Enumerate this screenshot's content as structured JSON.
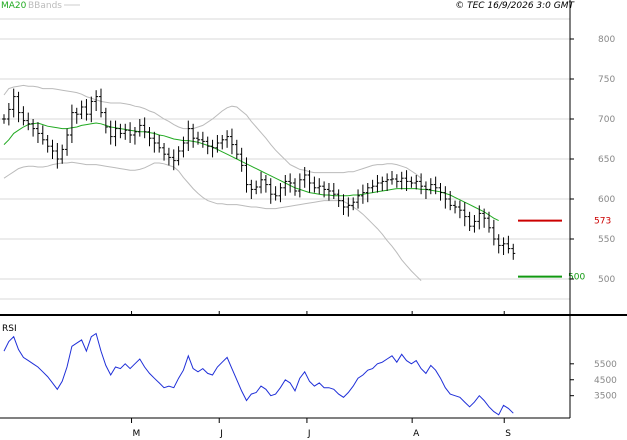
{
  "header": {
    "legend_ma": "MA20",
    "legend_bb": "BBands",
    "copyright": "© TEC 16/9/2026 3:0 GMT"
  },
  "colors": {
    "price": "#000000",
    "ma": "#22aa22",
    "bbands": "#bbbbbb",
    "rsi": "#1f2fd8",
    "resistance": "#cc0000",
    "support": "#119911",
    "grid": "#d8d8d8",
    "axis": "#000000"
  },
  "chart_data": [
    {
      "type": "ohlc",
      "price_axis": {
        "ticks": [
          800,
          750,
          700,
          650,
          600,
          550,
          500
        ],
        "ylim": [
          455,
          830
        ]
      },
      "x_axis": {
        "labels": [
          "M",
          "J",
          "J",
          "A",
          "S"
        ],
        "positions": [
          30,
          50,
          70,
          94,
          115
        ],
        "xlim": [
          0,
          130
        ]
      },
      "levels": [
        {
          "value": 573,
          "label": "573",
          "kind": "resistance"
        },
        {
          "value": 503,
          "label": "500",
          "kind": "support"
        }
      ],
      "close": [
        700,
        712,
        728,
        708,
        698,
        694,
        688,
        682,
        674,
        666,
        660,
        650,
        662,
        680,
        708,
        706,
        715,
        706,
        722,
        728,
        708,
        690,
        678,
        688,
        682,
        686,
        680,
        684,
        692,
        684,
        676,
        670,
        664,
        656,
        652,
        648,
        660,
        670,
        688,
        676,
        674,
        672,
        666,
        664,
        670,
        674,
        678,
        668,
        656,
        642,
        618,
        612,
        615,
        624,
        618,
        606,
        604,
        614,
        622,
        620,
        610,
        624,
        630,
        620,
        614,
        616,
        612,
        610,
        606,
        598,
        590,
        592,
        596,
        604,
        608,
        614,
        616,
        620,
        622,
        624,
        625,
        622,
        626,
        622,
        620,
        622,
        616,
        612,
        618,
        614,
        608,
        600,
        592,
        590,
        586,
        578,
        566,
        572,
        582,
        576,
        564,
        550,
        542,
        544,
        538,
        532
      ],
      "ma20": [
        668,
        674,
        682,
        686,
        690,
        693,
        694,
        695,
        693,
        691,
        690,
        689,
        688,
        688,
        689,
        690,
        692,
        693,
        694,
        695,
        694,
        692,
        690,
        689,
        688,
        687,
        686,
        685,
        684,
        684,
        683,
        682,
        680,
        679,
        677,
        675,
        674,
        673,
        673,
        672,
        671,
        669,
        667,
        665,
        662,
        659,
        656,
        653,
        650,
        647,
        644,
        641,
        638,
        635,
        632,
        629,
        626,
        623,
        620,
        617,
        614,
        612,
        610,
        608,
        607,
        606,
        605,
        605,
        604,
        604,
        604,
        604,
        605,
        605,
        606,
        607,
        608,
        609,
        610,
        611,
        612,
        613,
        613,
        613,
        613,
        613,
        612,
        612,
        611,
        610,
        609,
        607,
        605,
        602,
        599,
        596,
        593,
        590,
        587,
        584,
        580,
        576,
        573
      ],
      "bb_upper": [
        730,
        738,
        740,
        741,
        742,
        741,
        741,
        740,
        738,
        738,
        738,
        737,
        736,
        735,
        734,
        733,
        731,
        728,
        726,
        724,
        722,
        721,
        720,
        720,
        720,
        719,
        718,
        716,
        715,
        713,
        710,
        708,
        704,
        700,
        697,
        693,
        690,
        688,
        688,
        688,
        690,
        692,
        696,
        700,
        705,
        710,
        714,
        716,
        715,
        710,
        705,
        697,
        690,
        683,
        676,
        668,
        661,
        655,
        649,
        643,
        640,
        637,
        636,
        634,
        633,
        633,
        633,
        633,
        633,
        633,
        633,
        634,
        634,
        636,
        638,
        640,
        642,
        643,
        643,
        644,
        644,
        643,
        641,
        639,
        635,
        631,
        626
      ],
      "bb_lower": [
        626,
        630,
        634,
        638,
        640,
        641,
        641,
        640,
        640,
        641,
        643,
        644,
        645,
        645,
        646,
        645,
        644,
        643,
        643,
        643,
        642,
        641,
        640,
        639,
        638,
        637,
        636,
        636,
        637,
        639,
        642,
        645,
        645,
        644,
        642,
        640,
        635,
        627,
        620,
        613,
        607,
        602,
        598,
        596,
        594,
        594,
        593,
        593,
        593,
        592,
        591,
        590,
        590,
        589,
        588,
        588,
        588,
        589,
        590,
        591,
        592,
        593,
        594,
        595,
        596,
        597,
        598,
        598,
        598,
        598,
        597,
        594,
        590,
        586,
        581,
        575,
        569,
        563,
        556,
        548,
        541,
        533,
        524,
        517,
        510,
        504,
        498
      ]
    },
    {
      "type": "line",
      "title": "RSI",
      "y_axis": {
        "ticks": [
          "5500",
          "4500",
          "3500"
        ],
        "tick_values": [
          0.55,
          0.45,
          0.35
        ],
        "ylim": [
          0.21,
          0.85
        ]
      },
      "rsi": [
        0.63,
        0.69,
        0.72,
        0.64,
        0.59,
        0.57,
        0.55,
        0.53,
        0.5,
        0.47,
        0.43,
        0.39,
        0.44,
        0.53,
        0.66,
        0.68,
        0.7,
        0.63,
        0.72,
        0.74,
        0.63,
        0.54,
        0.48,
        0.53,
        0.52,
        0.55,
        0.52,
        0.55,
        0.58,
        0.53,
        0.49,
        0.46,
        0.43,
        0.4,
        0.41,
        0.4,
        0.46,
        0.51,
        0.6,
        0.52,
        0.5,
        0.52,
        0.49,
        0.48,
        0.53,
        0.56,
        0.59,
        0.52,
        0.45,
        0.38,
        0.32,
        0.36,
        0.37,
        0.41,
        0.39,
        0.35,
        0.36,
        0.4,
        0.45,
        0.43,
        0.38,
        0.46,
        0.5,
        0.44,
        0.41,
        0.43,
        0.4,
        0.4,
        0.39,
        0.36,
        0.34,
        0.37,
        0.41,
        0.46,
        0.48,
        0.51,
        0.52,
        0.55,
        0.56,
        0.58,
        0.6,
        0.56,
        0.61,
        0.57,
        0.55,
        0.57,
        0.52,
        0.49,
        0.54,
        0.51,
        0.46,
        0.4,
        0.36,
        0.35,
        0.34,
        0.31,
        0.28,
        0.31,
        0.35,
        0.32,
        0.28,
        0.25,
        0.23,
        0.29,
        0.27,
        0.24
      ]
    }
  ]
}
